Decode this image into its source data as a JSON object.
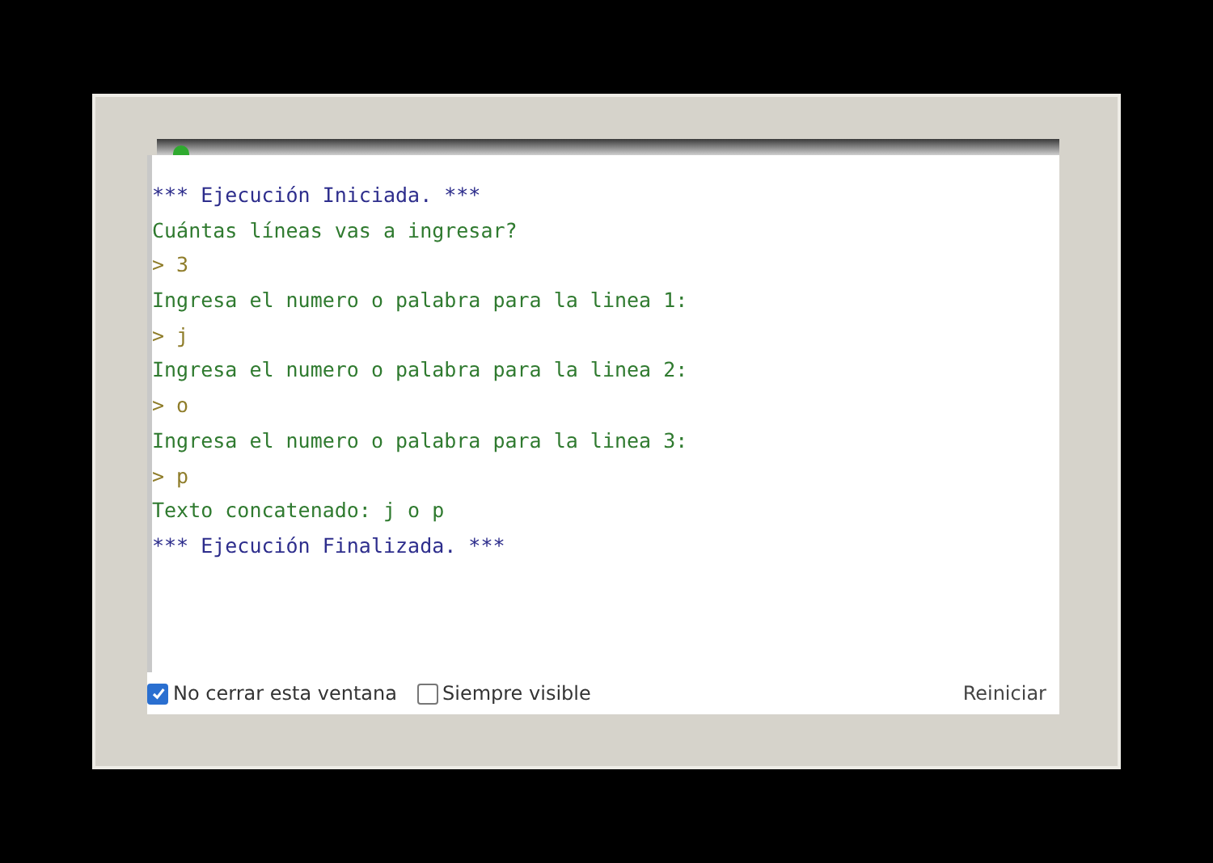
{
  "console": {
    "lines": [
      {
        "kind": "system",
        "text": "*** Ejecución Iniciada. ***"
      },
      {
        "kind": "output",
        "text": "Cuántas líneas vas a ingresar?"
      },
      {
        "kind": "input",
        "text": "> 3"
      },
      {
        "kind": "output",
        "text": "Ingresa el numero o palabra para la linea 1:"
      },
      {
        "kind": "input",
        "text": "> j"
      },
      {
        "kind": "output",
        "text": "Ingresa el numero o palabra para la linea 2:"
      },
      {
        "kind": "input",
        "text": "> o"
      },
      {
        "kind": "output",
        "text": "Ingresa el numero o palabra para la linea 3:"
      },
      {
        "kind": "input",
        "text": "> p"
      },
      {
        "kind": "output",
        "text": "Texto concatenado: j o p"
      },
      {
        "kind": "system",
        "text": "*** Ejecución Finalizada. ***"
      }
    ]
  },
  "options": [
    {
      "label": "No cerrar esta ventana",
      "checked": true
    },
    {
      "label": "Siempre visible",
      "checked": false
    }
  ],
  "buttons": [
    "Reiniciar"
  ]
}
